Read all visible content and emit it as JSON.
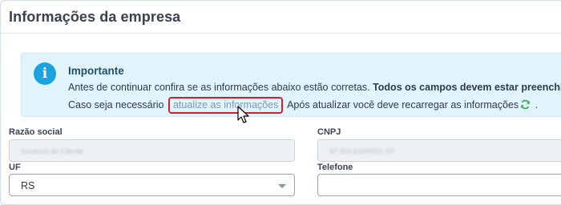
{
  "page": {
    "title": "Informações da empresa"
  },
  "alert": {
    "icon": "info-icon",
    "title": "Importante",
    "line1_text": "Antes de continuar confira se as informações abaixo estão corretas. ",
    "line1_bold": "Todos os campos devem estar preenchidos.",
    "line2_before": "Caso seja necessário ",
    "link_label": "atualize as informações",
    "line2_after": " Após atualizar você deve recarregar as informações",
    "line2_end": " .",
    "refresh_icon": "refresh-icon",
    "accent_color": "#1aa3e0",
    "highlight_color": "#d0202a"
  },
  "form": {
    "razao_social": {
      "label": "Razão social",
      "value": "Sucesso do Cliente"
    },
    "cnpj": {
      "label": "CNPJ",
      "value": "97.304.610/0001-07"
    },
    "uf": {
      "label": "UF",
      "value": "RS"
    },
    "telefone": {
      "label": "Telefone",
      "value": ""
    }
  }
}
